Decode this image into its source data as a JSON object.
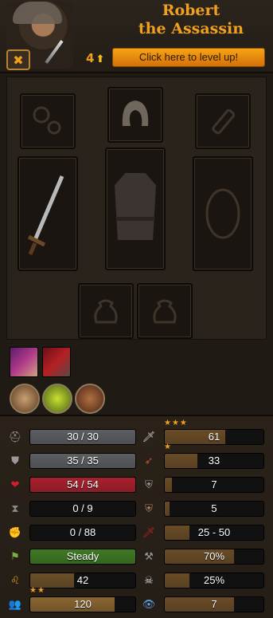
{
  "character": {
    "name_line1": "Robert",
    "name_line2": "the Assassin",
    "level": "4",
    "levelup_label": "Click here to level up!"
  },
  "stats_left": [
    {
      "key": "hitpoints",
      "value": "30 / 30",
      "fill": 1.0,
      "color": "#5c5e62",
      "icon": "helmet-icon",
      "stars": ""
    },
    {
      "key": "body-armor",
      "value": "35 / 35",
      "fill": 1.0,
      "color": "#5c5e62",
      "icon": "armor-icon",
      "stars": ""
    },
    {
      "key": "health",
      "value": "54 / 54",
      "fill": 1.0,
      "color": "#a8202c",
      "icon": "heart-icon",
      "stars": ""
    },
    {
      "key": "fatigue",
      "value": "0 / 9",
      "fill": 0.0,
      "color": "#4a4a4a",
      "icon": "hourglass-icon",
      "stars": ""
    },
    {
      "key": "max-fatigue",
      "value": "0 / 88",
      "fill": 0.0,
      "color": "#4a4a4a",
      "icon": "strength-icon",
      "stars": ""
    },
    {
      "key": "morale",
      "value": "Steady",
      "fill": 1.0,
      "color": "#3f7a24",
      "icon": "flag-icon",
      "stars": ""
    },
    {
      "key": "resolve",
      "value": "42",
      "fill": 0.42,
      "color": "#6a5028",
      "icon": "lion-icon",
      "stars": ""
    },
    {
      "key": "initiative",
      "value": "120",
      "fill": 0.8,
      "color": "#8a6530",
      "icon": "people-icon",
      "stars": "★★"
    }
  ],
  "stats_right": [
    {
      "key": "melee-skill",
      "value": "61",
      "fill": 0.61,
      "color": "#6a4c26",
      "icon": "sword-icon",
      "stars": "★★★"
    },
    {
      "key": "ranged-skill",
      "value": "33",
      "fill": 0.33,
      "color": "#6a4c26",
      "icon": "bow-icon",
      "stars": "★"
    },
    {
      "key": "melee-defense",
      "value": "7",
      "fill": 0.07,
      "color": "#6a4c26",
      "icon": "shield-sword-icon",
      "stars": ""
    },
    {
      "key": "ranged-defense",
      "value": "5",
      "fill": 0.05,
      "color": "#6a4c26",
      "icon": "shield-arrow-icon",
      "stars": ""
    },
    {
      "key": "damage",
      "value": "25 - 50",
      "fill": 0.25,
      "color": "#6a4c26",
      "icon": "blood-blade-icon",
      "stars": ""
    },
    {
      "key": "armor-damage",
      "value": "70%",
      "fill": 0.7,
      "color": "#6a4c26",
      "icon": "axe-icon",
      "stars": ""
    },
    {
      "key": "headshot-chance",
      "value": "25%",
      "fill": 0.25,
      "color": "#6a4c26",
      "icon": "skull-icon",
      "stars": ""
    },
    {
      "key": "vision",
      "value": "7",
      "fill": 0.7,
      "color": "#6a4c26",
      "icon": "eye-icon",
      "stars": ""
    }
  ]
}
